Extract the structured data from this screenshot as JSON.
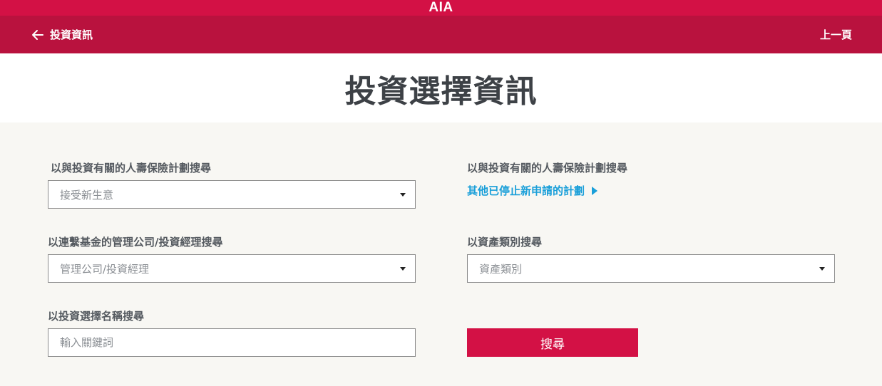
{
  "brand": {
    "logo_text": "AIA",
    "color_primary": "#d31145",
    "color_nav": "#b9123e",
    "color_link": "#1a9fd9"
  },
  "nav": {
    "back_label": "投資資訊",
    "back_icon": "arrow-left-icon",
    "prev_label": "上一頁"
  },
  "page": {
    "title": "投資選擇資訊"
  },
  "form": {
    "plan": {
      "label": "以與投資有關的人壽保險計劃搜尋",
      "placeholder": "接受新生意",
      "icon": "caret-down-icon"
    },
    "other_plans": {
      "label": "以與投資有關的人壽保險計劃搜尋",
      "link_text": "其他已停止新申請的計劃",
      "icon": "triangle-right-icon"
    },
    "manager": {
      "label": "以連繫基金的管理公司/投資經理搜尋",
      "placeholder": "管理公司/投資經理",
      "icon": "caret-down-icon"
    },
    "asset": {
      "label": "以資產類別搜尋",
      "placeholder": "資產類別",
      "icon": "caret-down-icon"
    },
    "name": {
      "label": "以投資選擇名稱搜尋",
      "placeholder": "輸入關鍵詞"
    },
    "search_button": "搜尋"
  }
}
